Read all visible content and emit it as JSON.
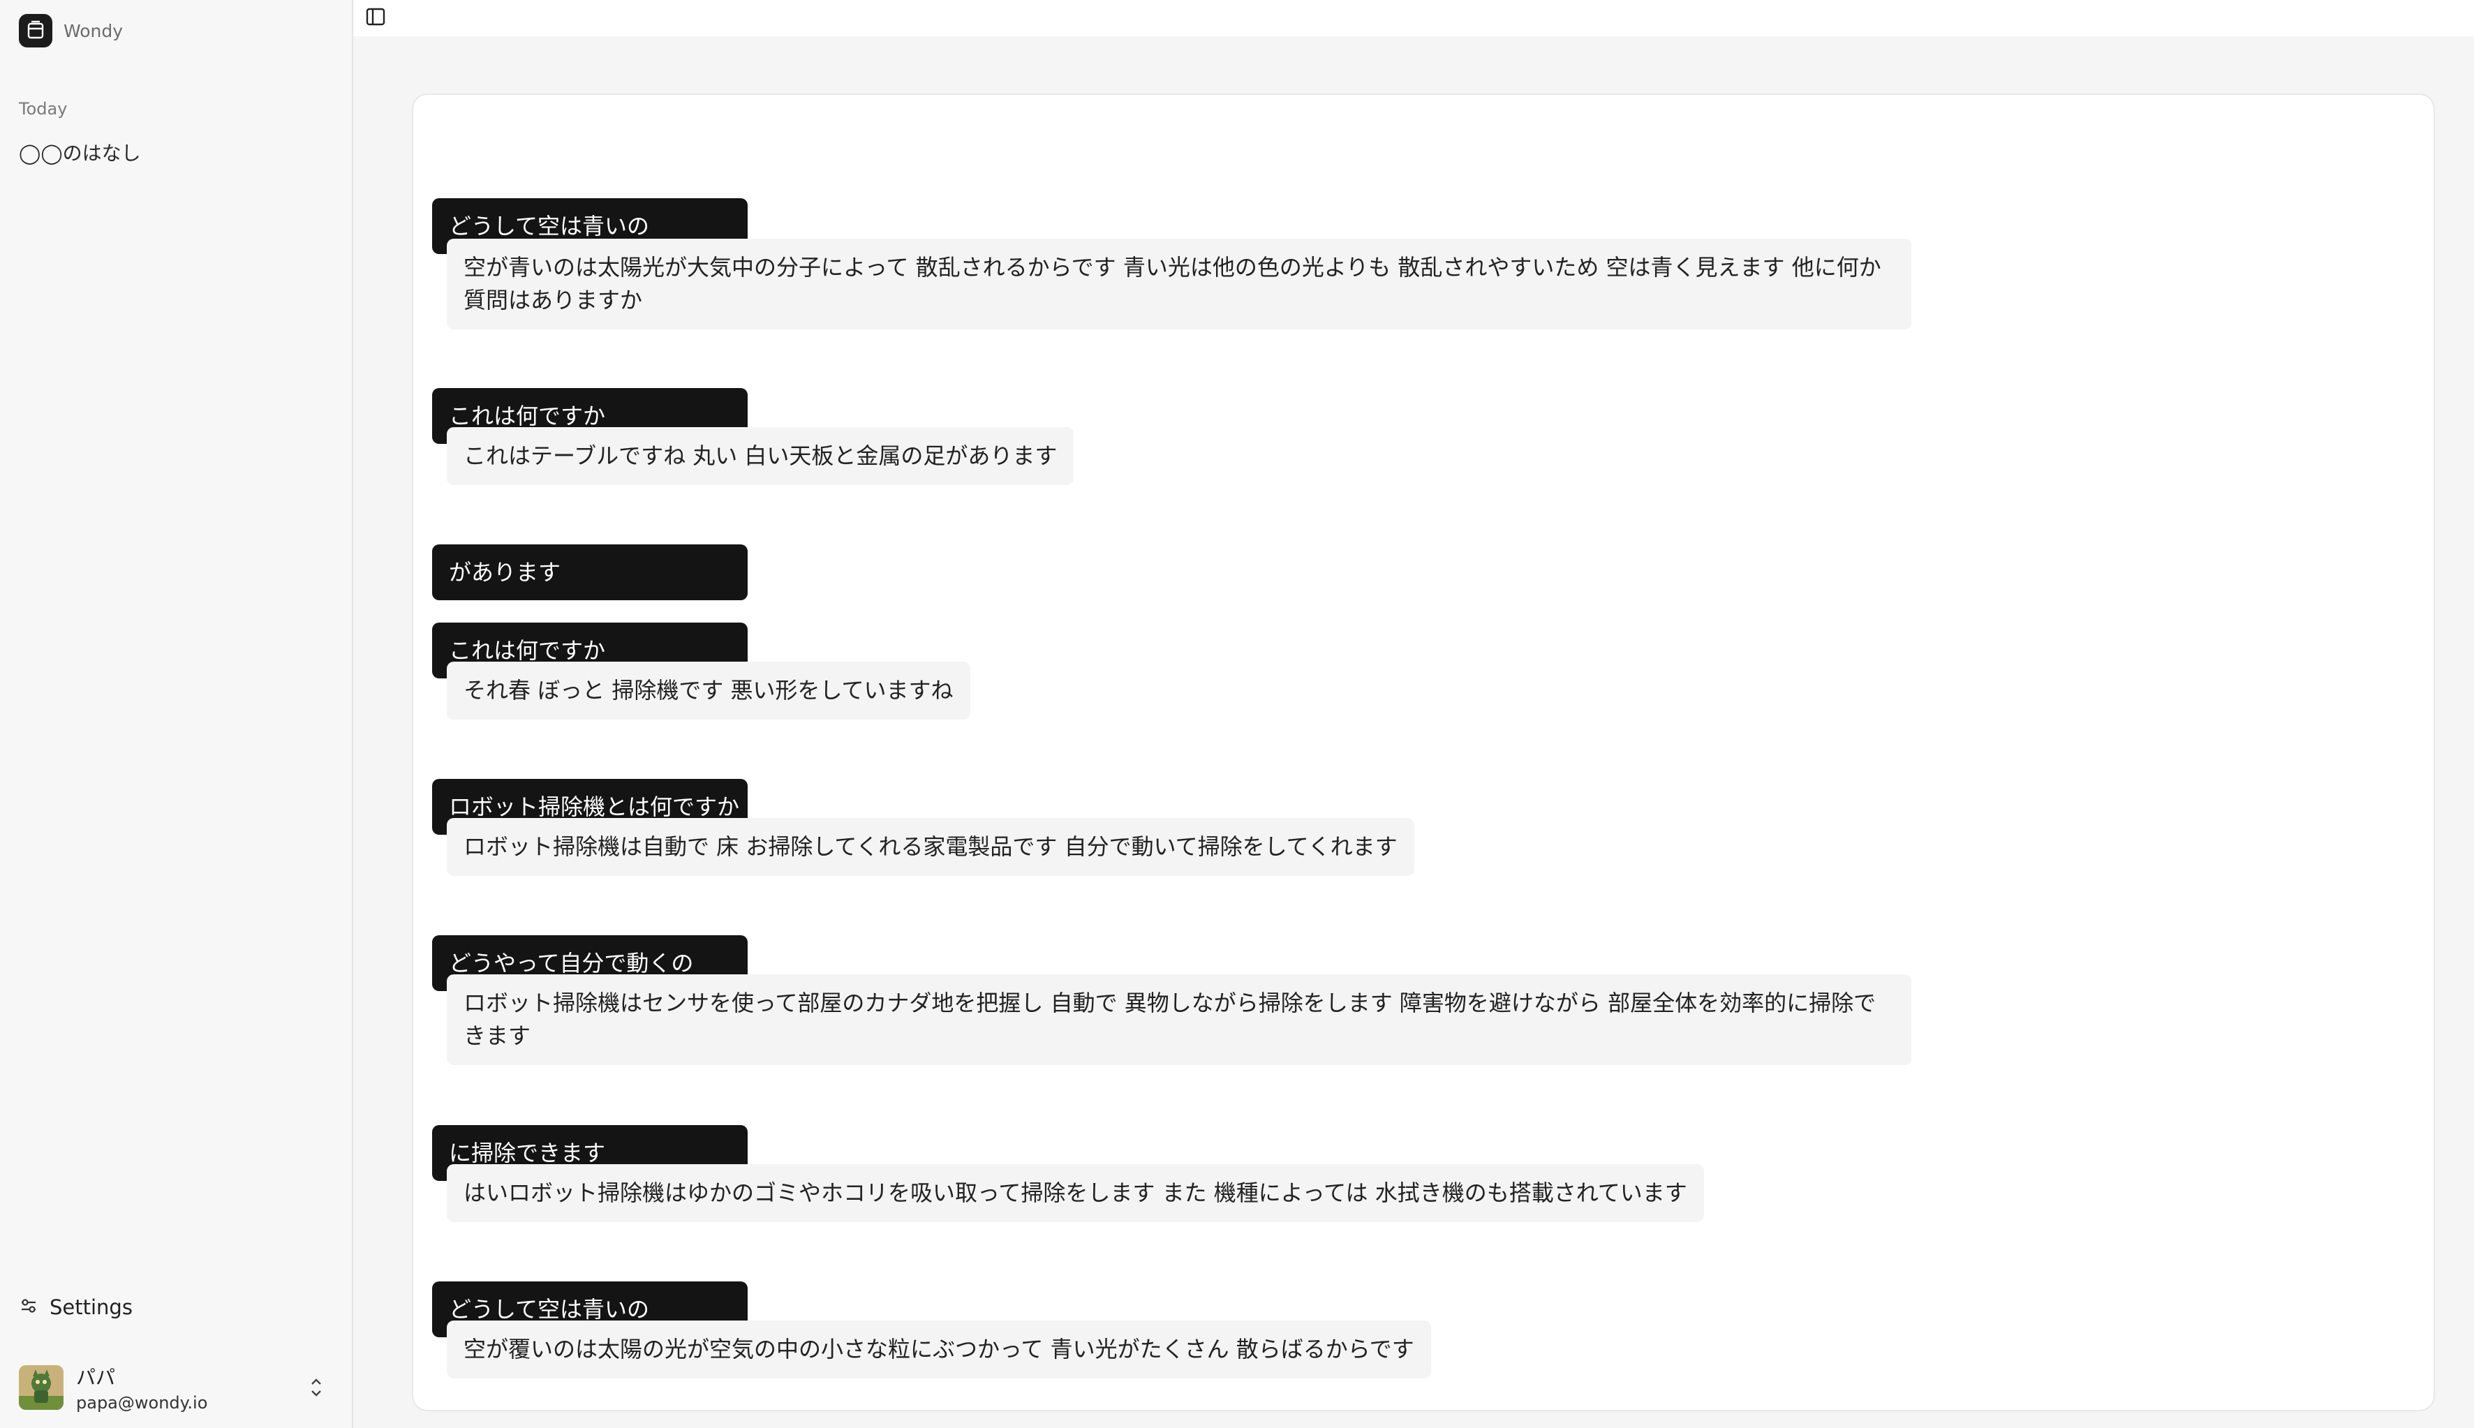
{
  "app": {
    "name": "Wondy"
  },
  "sidebar": {
    "section_label": "Today",
    "conversations": [
      {
        "title": "◯◯のはなし"
      }
    ],
    "settings_label": "Settings",
    "user": {
      "name": "パパ",
      "email": "papa@wondy.io"
    }
  },
  "icons": {
    "logo": "wondy-logo-icon",
    "sidebar_toggle": "panel-left-icon",
    "settings": "sliders-icon",
    "chevron": "chevrons-up-down-icon"
  },
  "colors": {
    "user_bubble": "#141414",
    "bot_bubble": "#f4f4f4",
    "background": "#f5f5f5",
    "sidebar": "#f7f7f7"
  },
  "chat": {
    "messages": [
      {
        "role": "user",
        "text": "どうして空は青いの"
      },
      {
        "role": "assistant",
        "text": "空が青いのは太陽光が大気中の分子によって 散乱されるからです 青い光は他の色の光よりも 散乱されやすいため 空は青く見えます 他に何か質問はありますか"
      },
      {
        "role": "user",
        "text": "これは何ですか"
      },
      {
        "role": "assistant",
        "text": "これはテーブルですね 丸い 白い天板と金属の足があります"
      },
      {
        "role": "user",
        "text": "があります"
      },
      {
        "role": "user",
        "text": "これは何ですか"
      },
      {
        "role": "assistant",
        "text": "それ春 ぼっと 掃除機です 悪い形をしていますね"
      },
      {
        "role": "user",
        "text": "ロボット掃除機とは何ですか"
      },
      {
        "role": "assistant",
        "text": "ロボット掃除機は自動で 床 お掃除してくれる家電製品です 自分で動いて掃除をしてくれます"
      },
      {
        "role": "user",
        "text": "どうやって自分で動くの"
      },
      {
        "role": "assistant",
        "text": "ロボット掃除機はセンサを使って部屋のカナダ地を把握し 自動で 異物しながら掃除をします 障害物を避けながら 部屋全体を効率的に掃除できます"
      },
      {
        "role": "user",
        "text": "に掃除できます"
      },
      {
        "role": "assistant",
        "text": "はいロボット掃除機はゆかのゴミやホコリを吸い取って掃除をします また 機種によっては 水拭き機のも搭載されています"
      },
      {
        "role": "user",
        "text": "どうして空は青いの"
      },
      {
        "role": "assistant",
        "text": "空が覆いのは太陽の光が空気の中の小さな粒にぶつかって 青い光がたくさん 散らばるからです"
      }
    ]
  }
}
